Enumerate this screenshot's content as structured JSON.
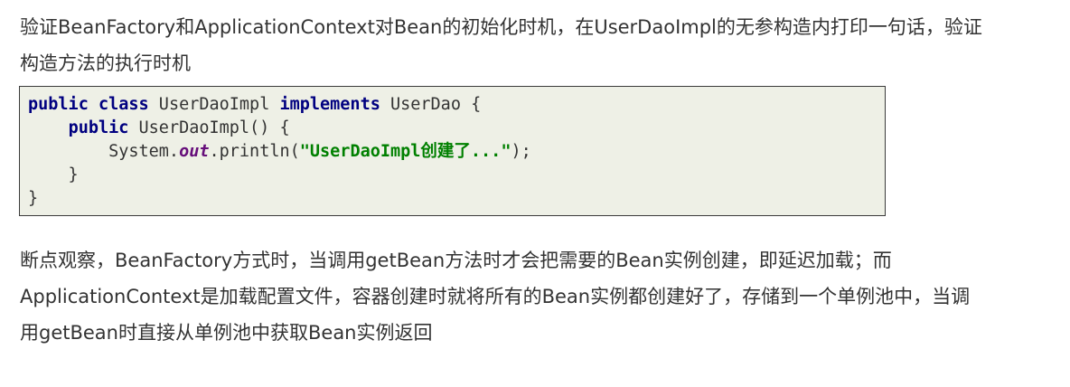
{
  "intro": {
    "line1": "验证BeanFactory和ApplicationContext对Bean的初始化时机，在UserDaoImpl的无参构造内打印一句话，验证",
    "line2": "构造方法的执行时机"
  },
  "code": {
    "line1": {
      "indent": "",
      "kw1": "public",
      "sp1": " ",
      "kw2": "class",
      "t1": " UserDaoImpl ",
      "kw3": "implements",
      "t2": " UserDao {"
    },
    "line2": {
      "indent": "    ",
      "kw1": "public",
      "t1": " UserDaoImpl() {"
    },
    "line3": {
      "indent": "        ",
      "t1": "System.",
      "field": "out",
      "t2": ".println(",
      "str": "\"UserDaoImpl创建了...\"",
      "t3": ");"
    },
    "line4": "    }",
    "line5": "}"
  },
  "outro": {
    "line1": "断点观察，BeanFactory方式时，当调用getBean方法时才会把需要的Bean实例创建，即延迟加载；而",
    "line2": "ApplicationContext是加载配置文件，容器创建时就将所有的Bean实例都创建好了，存储到一个单例池中，当调",
    "line3": "用getBean时直接从单例池中获取Bean实例返回"
  },
  "colors": {
    "text": "#333333",
    "code_background": "#eef0e6",
    "code_border": "#3a3a3a",
    "keyword": "#000080",
    "static_field": "#660e7a",
    "string": "#008000"
  }
}
